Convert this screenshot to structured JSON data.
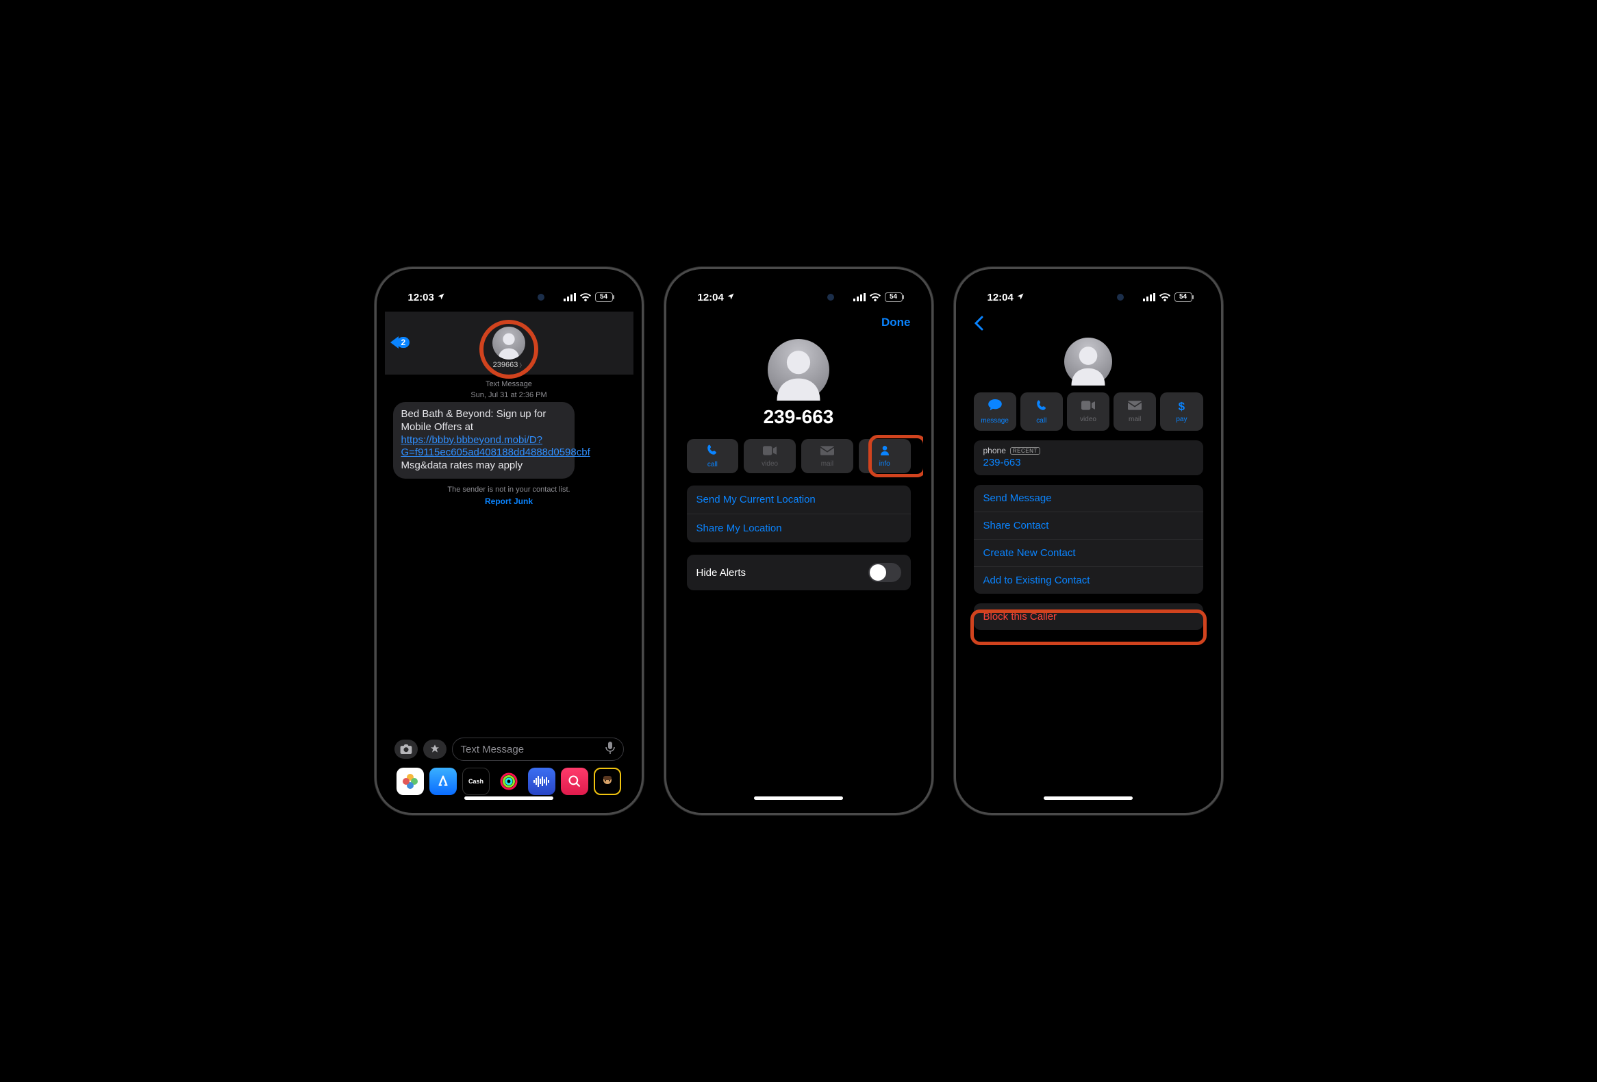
{
  "status": {
    "time1": "12:03",
    "time2": "12:04",
    "time3": "12:04",
    "battery": "54"
  },
  "screen1": {
    "back_count": "2",
    "sender": "239663",
    "meta1": "Text Message",
    "meta2": "Sun, Jul 31 at 2:36 PM",
    "msg_pre": "Bed Bath & Beyond: Sign up for Mobile Offers at ",
    "link1": "https://bbby.bbbeyond.mobi/D?G=f9115ec605ad408188dd4888d0598cbf",
    "msg_post": " Msg&data rates may apply",
    "note": "The sender is not in your contact list.",
    "report": "Report Junk",
    "input_placeholder": "Text Message"
  },
  "screen2": {
    "done": "Done",
    "number": "239-663",
    "chips": {
      "call": "call",
      "video": "video",
      "mail": "mail",
      "info": "info"
    },
    "send_loc": "Send My Current Location",
    "share_loc": "Share My Location",
    "hide_alerts": "Hide Alerts"
  },
  "screen3": {
    "actions": {
      "message": "message",
      "call": "call",
      "video": "video",
      "mail": "mail",
      "pay": "pay"
    },
    "phone_label": "phone",
    "recent": "RECENT",
    "phone_value": "239-663",
    "send_message": "Send Message",
    "share_contact": "Share Contact",
    "create_contact": "Create New Contact",
    "add_existing": "Add to Existing Contact",
    "block": "Block this Caller"
  }
}
